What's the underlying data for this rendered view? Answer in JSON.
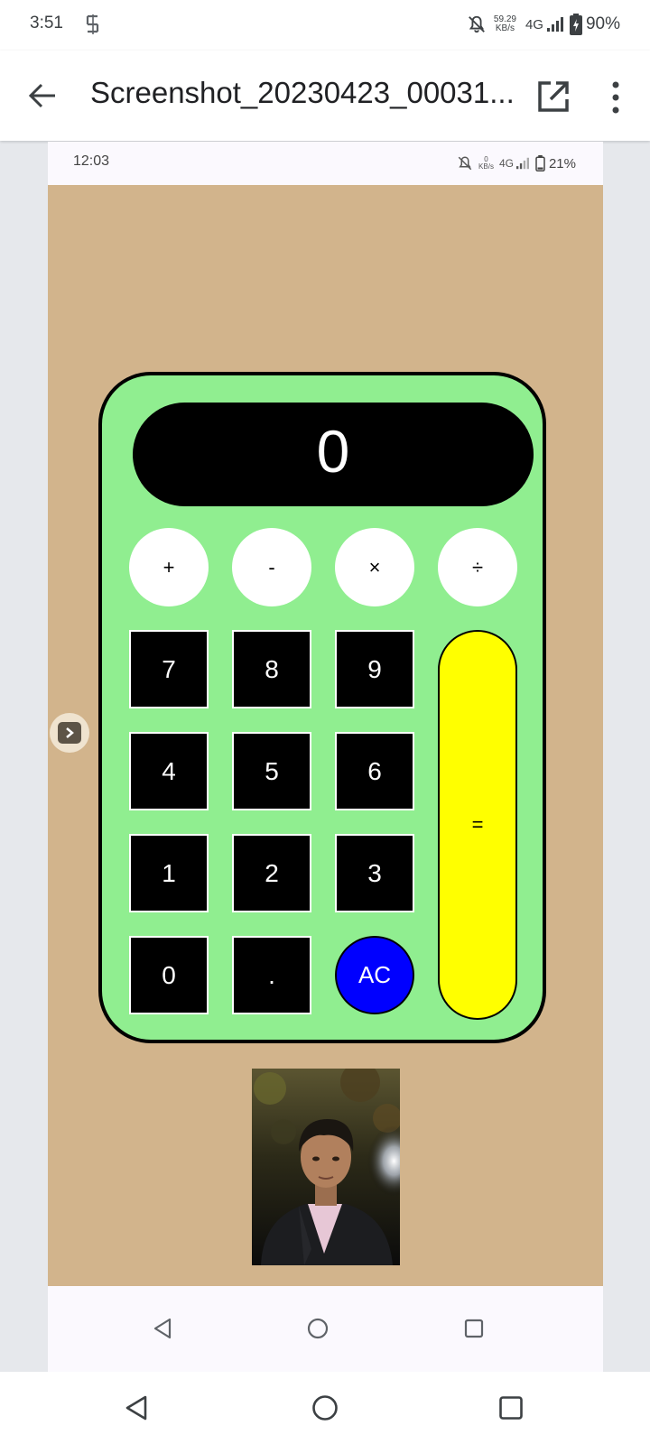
{
  "outer_status": {
    "time": "3:51",
    "speed_value": "59.29",
    "speed_unit": "KB/s",
    "network": "4G",
    "battery": "90%"
  },
  "app_bar": {
    "title": "Screenshot_20230423_00031...",
    "back_icon": "arrow-left-icon",
    "open_icon": "open-in-new-icon",
    "more_icon": "more-vert-icon"
  },
  "inner_status": {
    "time": "12:03",
    "speed_value": "0",
    "speed_unit": "KB/s",
    "network": "4G",
    "battery": "21%"
  },
  "calculator": {
    "display": "0",
    "operators": [
      "+",
      "-",
      "×",
      "÷"
    ],
    "rows": [
      [
        "7",
        "8",
        "9"
      ],
      [
        "4",
        "5",
        "6"
      ],
      [
        "1",
        "2",
        "3"
      ],
      [
        "0",
        "."
      ]
    ],
    "clear_label": "AC",
    "equals_label": "=",
    "colors": {
      "background": "#d2b48c",
      "body": "#90ee90",
      "equals": "#ffff00",
      "clear": "#0000ff"
    }
  }
}
